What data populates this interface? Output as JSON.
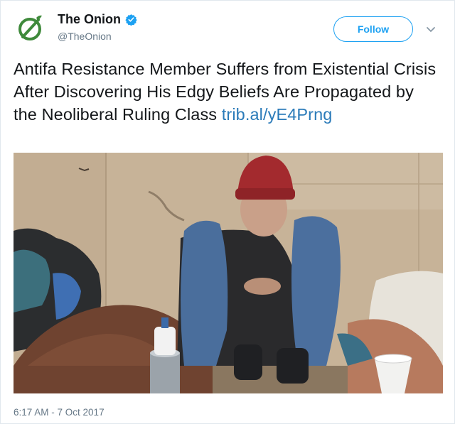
{
  "tweet": {
    "author_name": "The Onion",
    "author_handle": "@TheOnion",
    "verified": true,
    "follow_label": "Follow",
    "text": "Antifa Resistance Member Suffers from Existential Crisis After Discovering His Edgy Beliefs Are Propagated by the Neoliberal Ruling Class",
    "link": "trib.al/yE4Prng",
    "timestamp": "6:17 AM - 7 Oct 2017"
  },
  "icons": {
    "logo": "onion-logo-icon",
    "verified": "verified-badge-icon",
    "menu": "chevron-down-icon"
  },
  "colors": {
    "twitter_blue": "#1da1f2",
    "link": "#2b7bb9",
    "onion_green": "#3f8a3b",
    "text": "#14171a",
    "secondary": "#657786"
  }
}
